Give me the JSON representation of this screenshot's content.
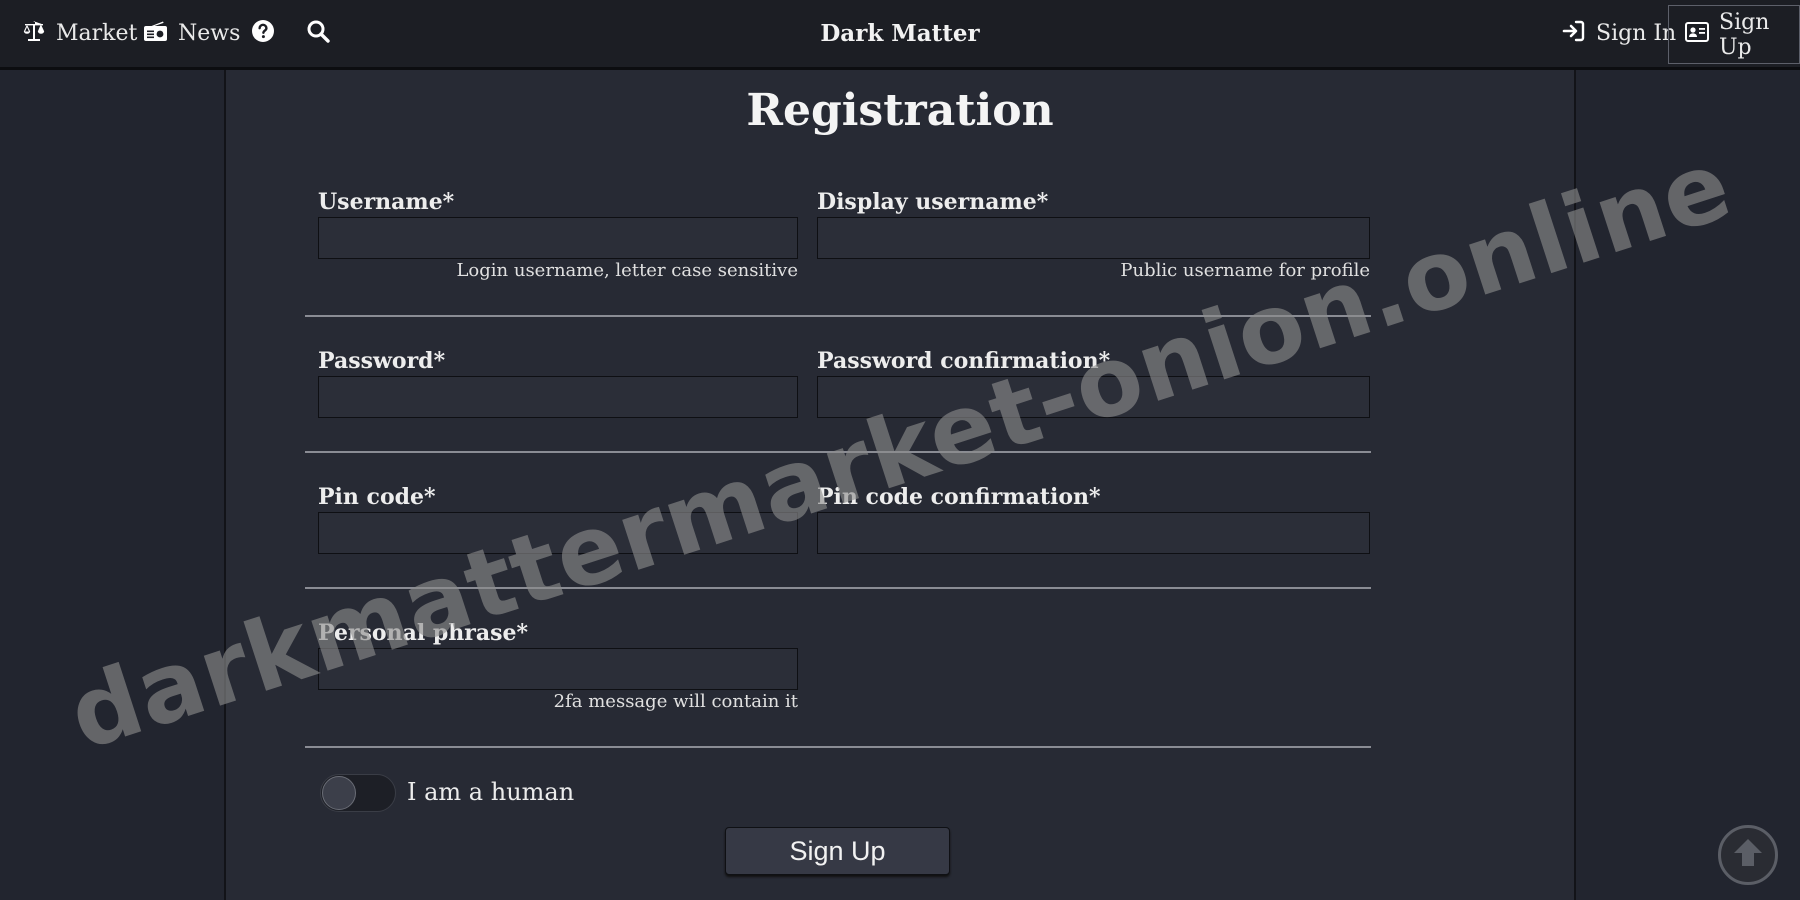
{
  "nav": {
    "market_label": "Market",
    "news_label": "News",
    "brand": "Dark Matter",
    "signin_label": "Sign In",
    "signup_label": "Sign Up",
    "icons": [
      "scales-icon",
      "radio-icon",
      "question-circle-icon",
      "search-icon",
      "sign-in-icon",
      "id-card-icon"
    ]
  },
  "form": {
    "title": "Registration",
    "username": {
      "label": "Username*",
      "value": "",
      "hint": "Login username, letter case sensitive"
    },
    "display_username": {
      "label": "Display username*",
      "value": "",
      "hint": "Public username for profile"
    },
    "password": {
      "label": "Password*",
      "value": ""
    },
    "password_confirmation": {
      "label": "Password confirmation*",
      "value": ""
    },
    "pin": {
      "label": "Pin code*",
      "value": ""
    },
    "pin_confirmation": {
      "label": "Pin code confirmation*",
      "value": ""
    },
    "personal_phrase": {
      "label": "Personal phrase*",
      "value": "",
      "hint": "2fa message will contain it"
    },
    "human_toggle": {
      "label": "I am a human",
      "checked": false
    },
    "submit_label": "Sign Up"
  },
  "watermark": "darkmattermarket-onion.online",
  "colors": {
    "background": "#22252f",
    "card": "#272a34",
    "topbar": "#1c1e24",
    "input": "#2b2e38",
    "button": "#363945"
  }
}
